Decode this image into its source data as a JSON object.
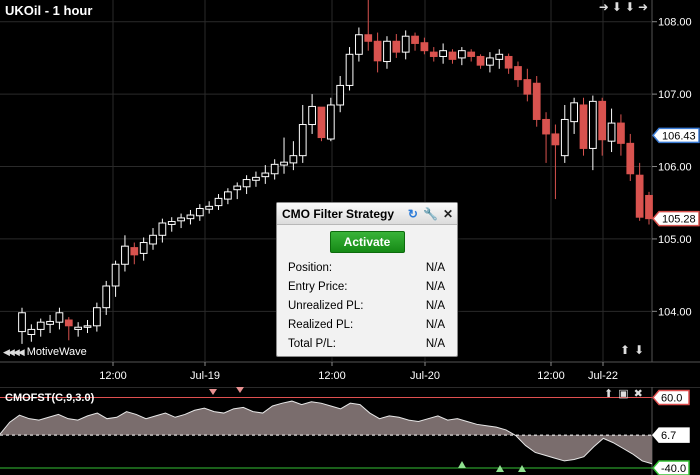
{
  "window": {
    "title": "UKOil - 1 hour",
    "brand": "MotiveWave"
  },
  "price_axis": {
    "labels": [
      "108.00",
      "107.00",
      "106.00",
      "105.00",
      "104.00"
    ],
    "markers": [
      {
        "label": "106.43",
        "value": 106.43,
        "color": "#3a7bd5"
      },
      {
        "label": "105.28",
        "value": 105.28,
        "color": "#d9534f"
      }
    ]
  },
  "time_axis": {
    "labels": [
      "12:00",
      "Jul-19",
      "12:00",
      "Jul-20",
      "12:00",
      "Jul-22"
    ]
  },
  "oscillator": {
    "title": "CMOFST(C,9,3.0)",
    "levels": [
      {
        "label": "60.0",
        "value": 60,
        "color": "#e05050"
      },
      {
        "label": "6.7",
        "value": 6.7,
        "color": "#ffffff"
      },
      {
        "label": "-40.0",
        "value": -40,
        "color": "#33c033"
      }
    ]
  },
  "strategy_panel": {
    "title": "CMO Filter Strategy",
    "activate_label": "Activate",
    "rows": [
      {
        "label": "Position:",
        "value": "N/A"
      },
      {
        "label": "Entry Price:",
        "value": "N/A"
      },
      {
        "label": "Unrealized PL:",
        "value": "N/A"
      },
      {
        "label": "Realized PL:",
        "value": "N/A"
      },
      {
        "label": "Total P/L:",
        "value": "N/A"
      }
    ]
  },
  "icons": {
    "top": [
      "arrow-right-icon",
      "arrow-down-icon",
      "arrow-down-icon",
      "arrow-right-icon"
    ],
    "panel": [
      "refresh-icon",
      "wrench-icon",
      "close-icon"
    ],
    "osc": [
      "arrow-up-icon",
      "window-icon",
      "close-icon"
    ],
    "nav": [
      "arrow-up-icon",
      "arrow-down-icon"
    ]
  },
  "colors": {
    "up_candle_fill": "#000000",
    "up_candle_border": "#ffffff",
    "down_candle": "#d9534f",
    "grid": "#2a2a2a",
    "osc_fill": "#7a6d6d",
    "activate": "#1f9d1f"
  },
  "chart_data": {
    "type": "candlestick",
    "series": [
      {
        "name": "UKOil",
        "o": [
          103.72,
          103.68,
          103.75,
          103.82,
          103.85,
          103.88,
          103.75,
          103.78,
          103.8,
          104.05,
          104.35,
          104.65,
          104.88,
          104.8,
          104.93,
          105.05,
          105.2,
          105.25,
          105.28,
          105.32,
          105.41,
          105.46,
          105.55,
          105.68,
          105.72,
          105.81,
          105.86,
          105.9,
          106.02,
          106.05,
          106.15,
          106.58,
          106.82,
          106.38,
          106.85,
          107.12,
          107.55,
          107.82,
          107.73,
          107.45,
          107.73,
          107.58,
          107.8,
          107.71,
          107.58,
          107.52,
          107.58,
          107.5,
          107.58,
          107.52,
          107.4,
          107.48,
          107.52,
          107.38,
          107.2,
          107.15,
          106.65,
          106.45,
          106.15,
          106.62,
          106.85,
          106.25,
          106.9,
          106.35,
          106.6,
          106.32,
          105.88,
          105.6
        ]
      },
      {
        "name": "UKOil-close",
        "c": [
          103.98,
          103.75,
          103.85,
          103.86,
          103.98,
          103.8,
          103.78,
          103.8,
          104.05,
          104.35,
          104.65,
          104.9,
          104.78,
          104.95,
          105.05,
          105.22,
          105.24,
          105.29,
          105.33,
          105.42,
          105.45,
          105.56,
          105.65,
          105.73,
          105.82,
          105.85,
          105.91,
          106.03,
          106.06,
          106.15,
          106.58,
          106.83,
          106.4,
          106.85,
          107.12,
          107.55,
          107.82,
          107.73,
          107.46,
          107.73,
          107.58,
          107.8,
          107.7,
          107.6,
          107.52,
          107.6,
          107.48,
          107.6,
          107.52,
          107.4,
          107.5,
          107.55,
          107.36,
          107.2,
          107.0,
          106.65,
          106.45,
          106.3,
          106.65,
          106.88,
          106.25,
          106.9,
          106.37,
          106.6,
          106.32,
          105.9,
          105.3,
          105.28
        ]
      },
      {
        "name": "UKOil-high",
        "h": [
          104.05,
          103.82,
          103.9,
          103.95,
          104.05,
          103.92,
          103.85,
          103.88,
          104.12,
          104.42,
          104.7,
          105.05,
          104.95,
          105.02,
          105.15,
          105.28,
          105.3,
          105.35,
          105.4,
          105.48,
          105.52,
          105.62,
          105.7,
          105.78,
          105.88,
          105.93,
          106.02,
          106.1,
          106.4,
          106.35,
          106.85,
          107.0,
          106.7,
          106.95,
          107.25,
          107.65,
          107.92,
          108.55,
          107.85,
          107.8,
          107.83,
          107.88,
          107.85,
          107.78,
          107.65,
          107.7,
          107.62,
          107.65,
          107.62,
          107.55,
          107.58,
          107.62,
          107.56,
          107.45,
          107.35,
          107.25,
          106.75,
          106.58,
          106.85,
          106.95,
          106.95,
          106.98,
          106.95,
          106.8,
          106.72,
          106.45,
          106.05,
          105.65
        ]
      },
      {
        "name": "UKOil-low",
        "l": [
          103.55,
          103.58,
          103.65,
          103.7,
          103.75,
          103.6,
          103.65,
          103.7,
          103.72,
          103.95,
          104.2,
          104.55,
          104.65,
          104.7,
          104.85,
          104.95,
          105.1,
          105.15,
          105.2,
          105.25,
          105.35,
          105.4,
          105.48,
          105.55,
          105.62,
          105.72,
          105.76,
          105.82,
          105.9,
          105.95,
          106.05,
          106.45,
          106.35,
          106.35,
          106.75,
          107.05,
          107.45,
          107.6,
          107.3,
          107.35,
          107.5,
          107.48,
          107.6,
          107.55,
          107.45,
          107.42,
          107.42,
          107.4,
          107.45,
          107.35,
          107.3,
          107.35,
          107.28,
          107.1,
          106.9,
          106.55,
          106.05,
          105.55,
          106.05,
          106.45,
          106.15,
          105.95,
          106.15,
          106.2,
          106.15,
          105.8,
          105.25,
          105.2
        ]
      }
    ],
    "osc_values": [
      8,
      25,
      35,
      30,
      28,
      32,
      36,
      30,
      28,
      34,
      38,
      30,
      32,
      40,
      36,
      30,
      34,
      38,
      32,
      36,
      42,
      45,
      40,
      38,
      44,
      46,
      40,
      38,
      48,
      52,
      55,
      50,
      54,
      52,
      48,
      44,
      52,
      50,
      38,
      30,
      34,
      32,
      28,
      26,
      30,
      34,
      28,
      30,
      26,
      22,
      20,
      18,
      14,
      6,
      -8,
      -18,
      -22,
      -26,
      -30,
      -28,
      -24,
      -10,
      2,
      -4,
      -12,
      -20,
      -30,
      -34
    ],
    "y_range": [
      103.3,
      108.3
    ],
    "osc_range": [
      -50,
      75
    ]
  }
}
